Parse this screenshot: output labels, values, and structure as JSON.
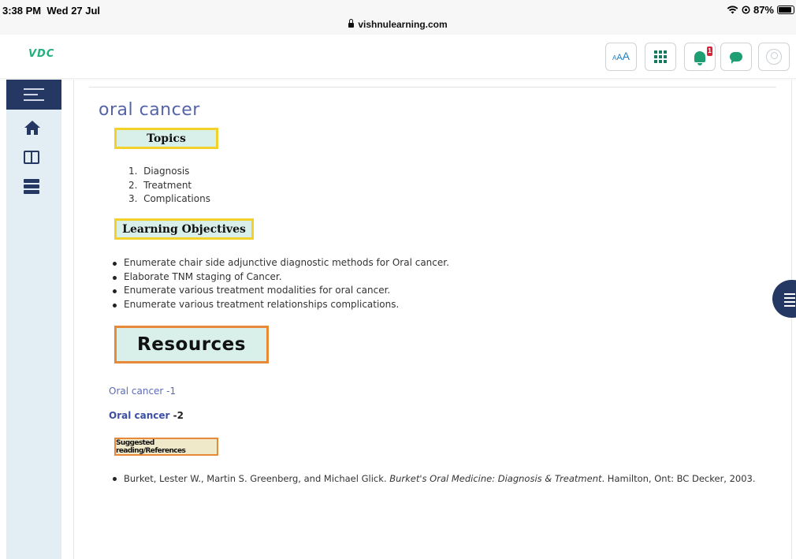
{
  "status_bar": {
    "time": "3:38 PM",
    "date": "Wed 27 Jul",
    "url": "vishnulearning.com",
    "battery": "87%"
  },
  "header": {
    "logo": "VDC",
    "font_size_button": {
      "small": "A",
      "medium": "A",
      "large": "A"
    },
    "notification_count": "1",
    "icons": [
      "font-size-icon",
      "grid-icon",
      "bell-icon",
      "chat-icon",
      "user-icon"
    ]
  },
  "sidebar": {
    "items": [
      "menu-icon",
      "home-icon",
      "book-icon",
      "server-icon"
    ]
  },
  "main": {
    "title": "oral cancer",
    "topics_heading": "Topics",
    "topics": [
      "Diagnosis",
      "Treatment",
      "Complications"
    ],
    "objectives_heading": "Learning Objectives",
    "objectives": [
      "Enumerate chair side adjunctive diagnostic methods for Oral cancer.",
      "Elaborate TNM staging of Cancer.",
      "Enumerate various treatment modalities for oral cancer.",
      "Enumerate various treatment relationships complications."
    ],
    "resources_heading": "Resources",
    "resource_links": [
      {
        "label": "Oral cancer -1"
      },
      {
        "label": "Oral cancer",
        "suffix": " -2"
      }
    ],
    "references_heading": "Suggested reading/References",
    "reference": {
      "authors": "Burket, Lester W., Martin S. Greenberg, and Michael Glick. ",
      "book_title": "Burket's Oral Medicine: Diagnosis & Treatment",
      "publisher": ". Hamilton, Ont: BC Decker, 2003."
    }
  },
  "colors": {
    "sidebar_bg": "#e3eef4",
    "nav_dark": "#253763",
    "title_blue": "#5564a8",
    "heading_box_bg": "#d9efe9",
    "yellow_border": "#f2d12b",
    "orange_border": "#e8893a",
    "accent_green": "#1e9e73"
  }
}
